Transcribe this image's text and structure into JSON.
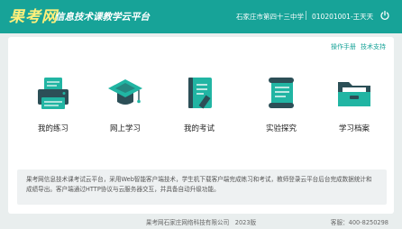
{
  "header": {
    "logo_text": "果考网",
    "title": "信息技术课教学云平台",
    "school": "石家庄市第四十三中学",
    "user": "010201001-王天天",
    "logout_icon": "power-icon"
  },
  "top_links": {
    "manual": "操作手册",
    "support": "技术支持"
  },
  "modules": [
    {
      "label": "我的练习",
      "icon": "printer-icon"
    },
    {
      "label": "网上学习",
      "icon": "graduation-cap-icon"
    },
    {
      "label": "我的考试",
      "icon": "exam-notebook-icon"
    },
    {
      "label": "实验探究",
      "icon": "scroll-icon"
    },
    {
      "label": "学习档案",
      "icon": "folder-icon"
    }
  ],
  "description": "果考网信息技术课考试云平台，采用Web智能客户端技术，学生机下载客户端完成练习和考试，教师登录云平台后台完成数据统计和成绩导出。客户端通过HTTP协议与云服务器交互，并具备自动升级功能。",
  "footer": {
    "copyright": "果考网石家庄网络科技有限公司　2023版",
    "phone": "客服：400-8250298"
  },
  "colors": {
    "primary": "#17a398",
    "logo": "#ffef7a",
    "icon_dark": "#2c4f57",
    "icon_light": "#21b5a3"
  }
}
